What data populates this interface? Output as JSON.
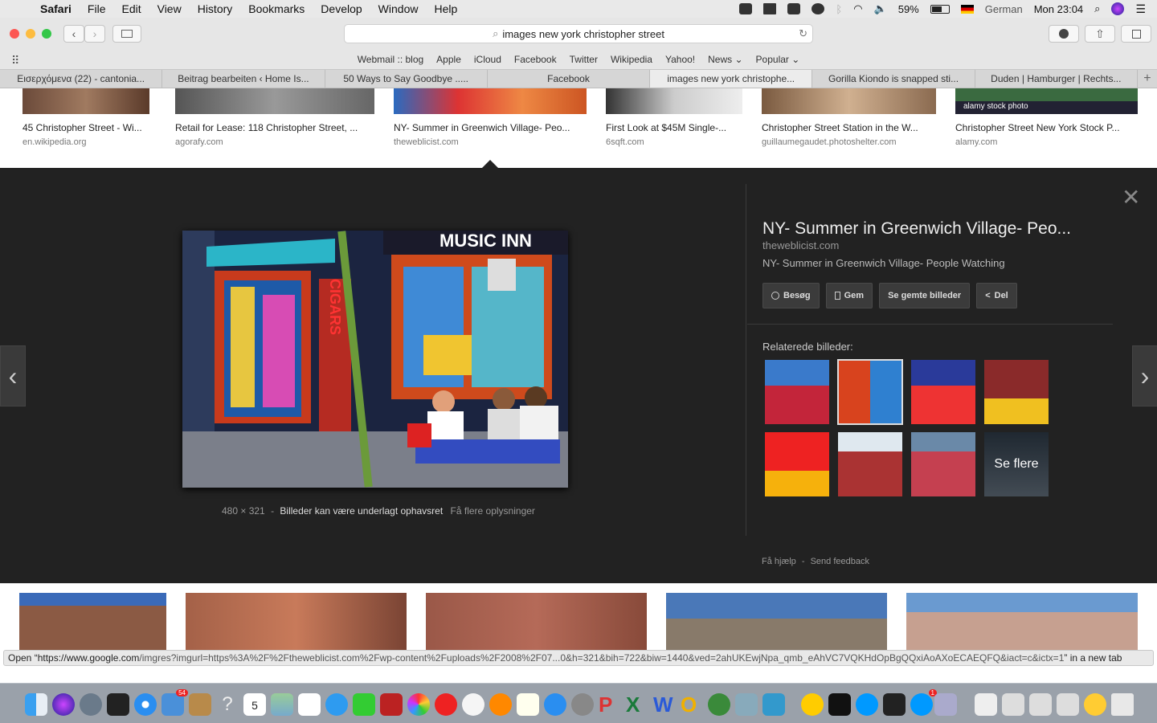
{
  "menubar": {
    "app": "Safari",
    "items": [
      "File",
      "Edit",
      "View",
      "History",
      "Bookmarks",
      "Develop",
      "Window",
      "Help"
    ],
    "battery": "59%",
    "input_source": "German",
    "clock": "Mon 23:04"
  },
  "toolbar": {
    "url_text": "images new york christopher street"
  },
  "bookmarks": [
    "Webmail :: blog",
    "Apple",
    "iCloud",
    "Facebook",
    "Twitter",
    "Wikipedia",
    "Yahoo!",
    "News ⌄",
    "Popular ⌄"
  ],
  "tabs": [
    {
      "label": "Εισερχόμενα (22) - cantonia...",
      "active": false
    },
    {
      "label": "Beitrag bearbeiten ‹ Home Is...",
      "active": false
    },
    {
      "label": "50 Ways to Say Goodbye .....",
      "active": false
    },
    {
      "label": "Facebook",
      "active": false
    },
    {
      "label": "images new york christophe...",
      "active": true
    },
    {
      "label": "Gorilla Kiondo is snapped sti...",
      "active": false
    },
    {
      "label": "Duden | Hamburger | Rechts...",
      "active": false
    }
  ],
  "results_top": [
    {
      "title": "45 Christopher Street - Wi...",
      "source": "en.wikipedia.org",
      "color": "#7a5a48"
    },
    {
      "title": "Retail for Lease: 118 Christopher Street, ...",
      "source": "agorafy.com",
      "color": "#555"
    },
    {
      "title": "NY- Summer in Greenwich Village- Peo...",
      "source": "theweblicist.com",
      "color": "#c33"
    },
    {
      "title": "First Look at $45M Single-...",
      "source": "6sqft.com",
      "color": "#aaa"
    },
    {
      "title": "Christopher Street Station in the W...",
      "source": "guillaumegaudet.photoshelter.com",
      "color": "#b49070"
    },
    {
      "title": "Christopher Street New York Stock P...",
      "source": "alamy.com",
      "color": "#334"
    }
  ],
  "alamy_watermark": "alamy stock photo",
  "panel": {
    "title": "NY- Summer in Greenwich Village- Peo...",
    "source": "theweblicist.com",
    "description": "NY- Summer in Greenwich Village- People Watching",
    "buttons": [
      {
        "icon": "globe-icon",
        "label": "Besøg"
      },
      {
        "icon": "bookmark-icon",
        "label": "Gem"
      },
      {
        "icon": "",
        "label": "Se gemte billeder"
      },
      {
        "icon": "share-icon",
        "label": "Del"
      }
    ],
    "image_size": "480 × 321",
    "separator": "-",
    "rights_text": "Billeder kan være underlagt ophavsret",
    "more_info": "Få flere oplysninger",
    "related_header": "Relaterede billeder:",
    "see_more": "Se flere",
    "footer_help": "Få hjælp",
    "footer_feedback": "Send feedback",
    "close_glyph": "✕",
    "prev_glyph": "‹",
    "next_glyph": "›"
  },
  "image_signs": {
    "cigars": "CIGARS",
    "music": "MUSIC INN"
  },
  "related": [
    {
      "colors": [
        "#c3253a",
        "#3a7acb"
      ]
    },
    {
      "colors": [
        "#d8431e",
        "#2f80d0"
      ]
    },
    {
      "colors": [
        "#2a3a9a",
        "#e33"
      ]
    },
    {
      "colors": [
        "#8a2a2a",
        "#f0c020"
      ]
    },
    {
      "colors": [
        "#e22",
        "#f6b10c"
      ]
    },
    {
      "colors": [
        "#a33",
        "#dfe8ef"
      ]
    },
    {
      "colors": [
        "#c54050",
        "#6a89a8"
      ]
    },
    {
      "colors": [
        "#3a4a5a",
        "#7a8a9a"
      ]
    }
  ],
  "results_bottom": [
    {
      "color": "#8b5a44"
    },
    {
      "color": "#a46148"
    },
    {
      "color": "#9a5848"
    },
    {
      "color": "#4a78b8"
    },
    {
      "color": "#6a9ad0"
    }
  ],
  "status": {
    "prefix": "Open “",
    "host": "https://www.google.com",
    "path": "/imgres?imgurl=https%3A%2F%2Ftheweblicist.com%2Fwp-content%2Fuploads%2F2008%2F07...0&h=321&bih=722&biw=1440&ved=2ahUKEwjNpa_qmb_eAhVC7VQKHdOpBgQQxiAoAXoECAEQFQ&iact=c&ictx=1",
    "suffix": "” in a new tab"
  },
  "dock": {
    "calendar_day": "5",
    "mail_badge": "54",
    "skype_badge": "1"
  }
}
